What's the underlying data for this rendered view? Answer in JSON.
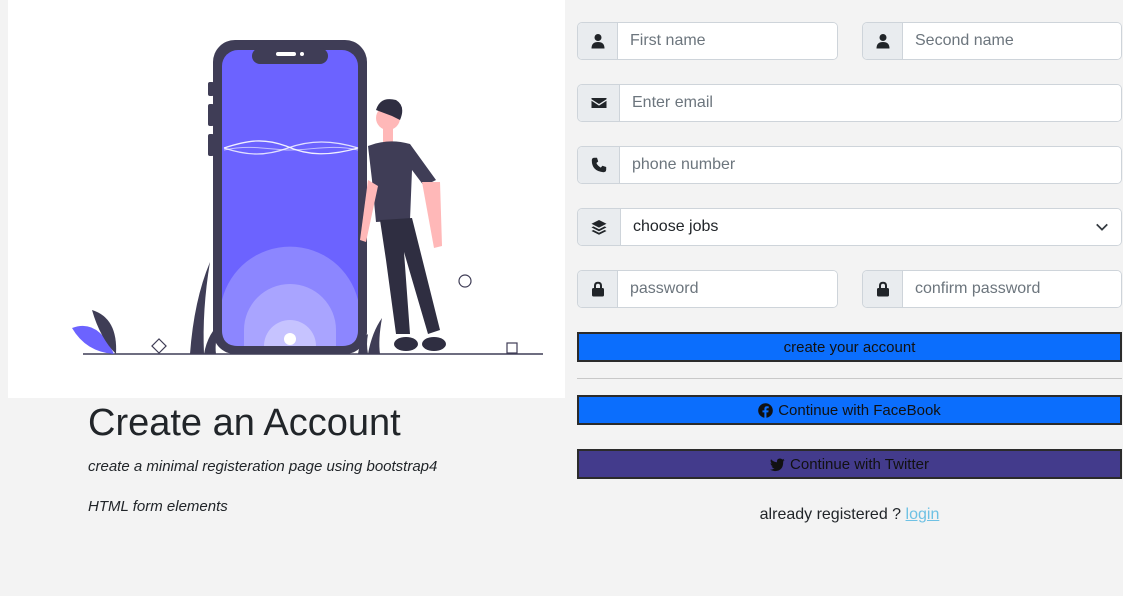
{
  "hero": {
    "title": "Create an Account",
    "subtitle": "create a minimal registeration page using bootstrap4",
    "subtitle2": "HTML form elements"
  },
  "form": {
    "first_name": {
      "placeholder": "First name",
      "icon": "user-icon"
    },
    "second_name": {
      "placeholder": "Second name",
      "icon": "user-icon"
    },
    "email": {
      "placeholder": "Enter email",
      "icon": "envelope-icon"
    },
    "phone": {
      "placeholder": "phone number",
      "icon": "phone-icon"
    },
    "jobs": {
      "selected": "choose jobs",
      "icon": "layers-icon"
    },
    "password": {
      "placeholder": "password",
      "icon": "lock-icon"
    },
    "confirm_password": {
      "placeholder": "confirm password",
      "icon": "lock-icon"
    },
    "create_label": "create your account",
    "facebook_label": "Continue with FaceBook",
    "twitter_label": "Continue with Twitter",
    "login_prompt": "already registered ?",
    "login_link": "login"
  },
  "colors": {
    "primary": "#0b6efd",
    "twitter": "#433b8c",
    "illustration_accent": "#6c63ff",
    "link": "#6ec1e4"
  }
}
